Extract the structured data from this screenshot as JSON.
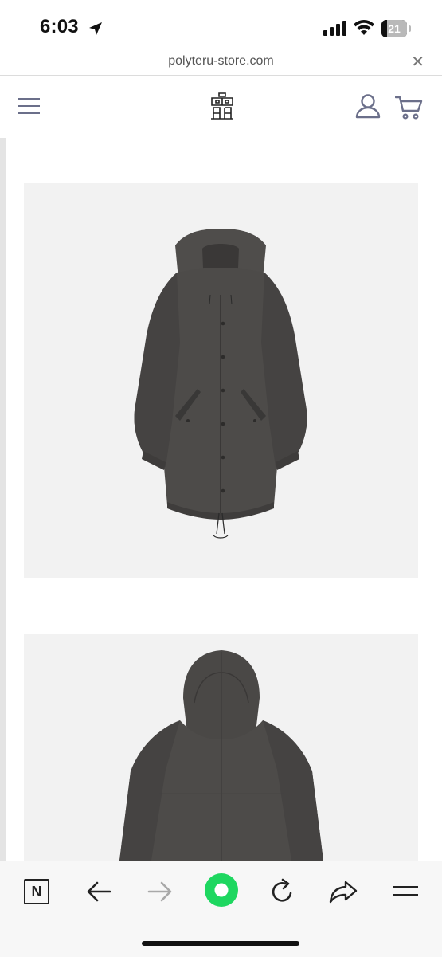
{
  "status_bar": {
    "time": "6:03",
    "battery_level": "21",
    "battery_fraction": 0.21,
    "icons": [
      "location-arrow-icon",
      "cellular-signal-icon",
      "wifi-icon",
      "battery-icon"
    ]
  },
  "browser": {
    "url": "polyteru-store.com",
    "close_icon": "close-icon",
    "toolbar_icons": [
      "n-app-icon",
      "back-arrow-icon",
      "forward-arrow-icon",
      "home-dot-icon",
      "reload-icon",
      "share-icon",
      "menu-icon"
    ],
    "forward_enabled": false,
    "accent_color": "#1ed760"
  },
  "site_header": {
    "icons": [
      "hamburger-menu-icon",
      "polyteru-logo",
      "account-icon",
      "cart-icon"
    ],
    "icon_color": "#6b6f8a"
  },
  "product_images": [
    {
      "subject": "jacket-front-image",
      "background": "#f2f2f2",
      "jacket_color": "#4d4b49"
    },
    {
      "subject": "jacket-back-image",
      "background": "#f2f2f2",
      "jacket_color": "#4d4b49"
    }
  ]
}
